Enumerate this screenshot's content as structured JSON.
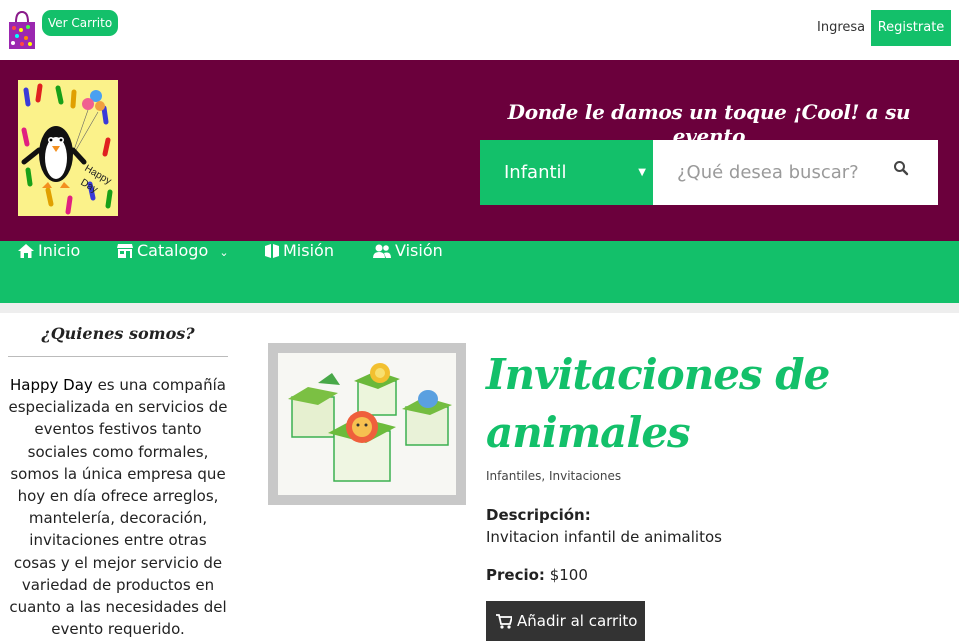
{
  "topbar": {
    "cart_label": "Ver Carrito",
    "login_label": "Ingresa",
    "register_label": "Registrate"
  },
  "header": {
    "logo_text": "Happy Day",
    "slogan": "Donde le damos un toque ¡Cool! a su evento",
    "category_selected": "Infantil",
    "search_placeholder": "¿Qué desea buscar?"
  },
  "nav": {
    "items": [
      {
        "label": "Inicio",
        "icon": "home-icon"
      },
      {
        "label": "Catalogo",
        "icon": "store-icon"
      },
      {
        "label": "Misión",
        "icon": "book-icon"
      },
      {
        "label": "Visión",
        "icon": "users-icon"
      }
    ]
  },
  "sidebar": {
    "title": "¿Quienes somos?",
    "brand": "Happy Day",
    "body": " es una compañía especializada en servicios de eventos festivos tanto sociales como formales, somos la única empresa que hoy en día ofrece arreglos, mantelería, decoración, invitaciones entre otras cosas y el mejor servicio de variedad de productos en cuanto a las necesidades del evento requerido."
  },
  "product": {
    "title": "Invitaciones de animales",
    "categories": "Infantiles, Invitaciones",
    "description_label": "Descripción:",
    "description": "Invitacion infantil de animalitos",
    "price_label": "Precio:",
    "price": "$100",
    "add_to_cart_label": "Añadir al carrito"
  },
  "colors": {
    "brand_green": "#13c06a",
    "header_maroon": "#6b003c",
    "button_dark": "#333333"
  }
}
